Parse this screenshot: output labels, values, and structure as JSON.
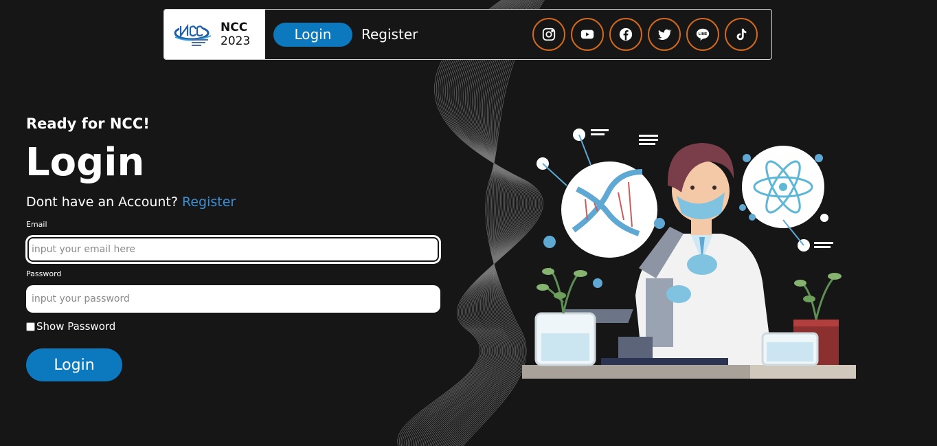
{
  "navbar": {
    "brand_name": "NCC",
    "brand_year": "2023",
    "login_label": "Login",
    "register_label": "Register",
    "socials": [
      "instagram-icon",
      "youtube-icon",
      "facebook-icon",
      "twitter-icon",
      "line-icon",
      "tiktok-icon"
    ],
    "social_border_color": "#d2691e",
    "accent": "#0c78be"
  },
  "form": {
    "tagline": "Ready for NCC!",
    "title": "Login",
    "account_prompt": "Dont have an Account?",
    "register_link": "Register",
    "email_label": "Email",
    "email_placeholder": "input your email here",
    "password_label": "Password",
    "password_placeholder": "input your password",
    "show_password_label": "Show Password",
    "submit_label": "Login"
  }
}
